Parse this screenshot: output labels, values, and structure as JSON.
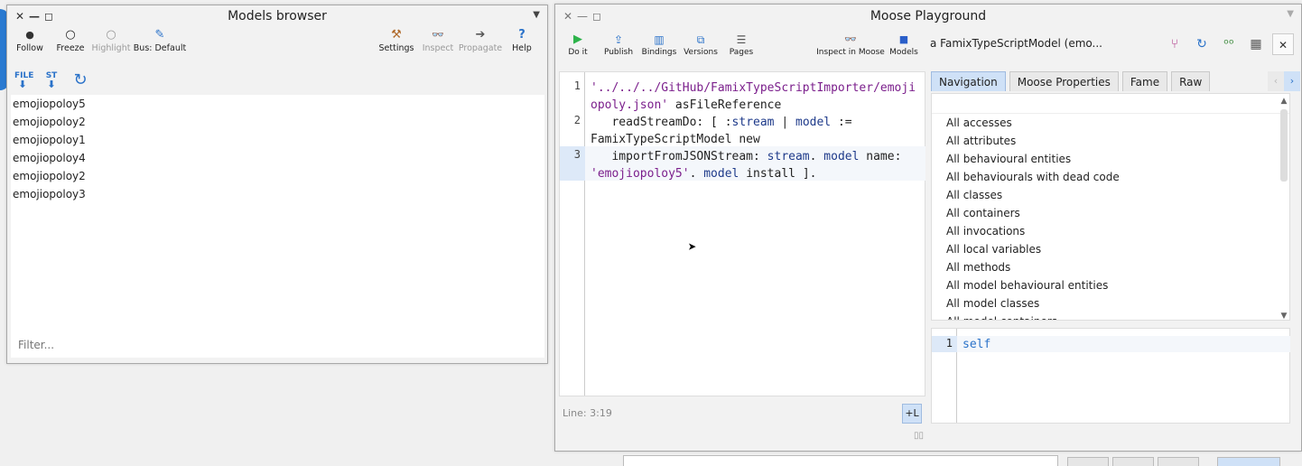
{
  "models_browser": {
    "title": "Models browser",
    "toolbar": [
      {
        "name": "follow",
        "label": "Follow",
        "icon": "●",
        "disabled": false
      },
      {
        "name": "freeze",
        "label": "Freeze",
        "icon": "○",
        "disabled": false
      },
      {
        "name": "highlight",
        "label": "Highlight",
        "icon": "○",
        "disabled": true
      },
      {
        "name": "bus",
        "label": "Bus: Default",
        "icon": "✎",
        "disabled": false
      },
      {
        "name": "settings",
        "label": "Settings",
        "icon": "⚒",
        "disabled": false
      },
      {
        "name": "inspect",
        "label": "Inspect",
        "icon": "👓",
        "disabled": true
      },
      {
        "name": "propagate",
        "label": "Propagate",
        "icon": "➔",
        "disabled": true
      },
      {
        "name": "help",
        "label": "Help",
        "icon": "?",
        "disabled": false
      }
    ],
    "icon_row": {
      "file_icon": "FILE",
      "st_icon": "ST",
      "refresh_icon": "↻"
    },
    "models": [
      "emojiopoloy5",
      "emojiopoloy2",
      "emojiopoloy1",
      "emojiopoloy4",
      "emojiopoloy2",
      "emojiopoloy3"
    ],
    "filter_placeholder": "Filter..."
  },
  "playground": {
    "title": "Moose Playground",
    "toolbar": [
      {
        "name": "do-it",
        "label": "Do it",
        "icon": "▶"
      },
      {
        "name": "publish",
        "label": "Publish",
        "icon": "⇪"
      },
      {
        "name": "bindings",
        "label": "Bindings",
        "icon": "▥"
      },
      {
        "name": "versions",
        "label": "Versions",
        "icon": "⧉"
      },
      {
        "name": "pages",
        "label": "Pages",
        "icon": "☰"
      },
      {
        "name": "inspect-in-moose",
        "label": "Inspect in Moose",
        "icon": "👓"
      },
      {
        "name": "models",
        "label": "Models",
        "icon": "■"
      }
    ],
    "model_label": "a FamixTypeScriptModel (emo...",
    "code_line_numbers": [
      "1",
      "2",
      "3"
    ],
    "code": {
      "l1a": "'../../../GitHub/FamixTypeScriptImporter/emoji",
      "l1b": "opoly.json'",
      "l1c": " asFileReference",
      "l2a": "   readStreamDo: [ :",
      "l2b": "stream",
      "l2c": " | ",
      "l2d": "model",
      "l2e": " :=",
      "l2f": "FamixTypeScriptModel new",
      "l3a": "   importFromJSONStream: ",
      "l3b": "stream",
      "l3c": ". ",
      "l3d": "model",
      "l3e": " name:",
      "l3f": "'emojiopoloy5'",
      "l3g": ". ",
      "l3h": "model",
      "l3i": " install ]."
    },
    "status": "Line: 3:19",
    "plus_l": "+L",
    "tabs": [
      {
        "label": "Navigation",
        "selected": true
      },
      {
        "label": "Moose Properties",
        "selected": false
      },
      {
        "label": "Fame",
        "selected": false
      },
      {
        "label": "Raw",
        "selected": false
      }
    ],
    "nav_items": [
      "All accesses",
      "All attributes",
      "All behavioural entities",
      "All behaviourals with dead code",
      "All classes",
      "All containers",
      "All invocations",
      "All local variables",
      "All methods",
      "All model behavioural entities",
      "All model classes",
      "All model containers"
    ],
    "mini_editor": {
      "line": "1",
      "code": "self"
    }
  },
  "colors": {
    "accent": "#2a72c9",
    "selected_tab": "#cfe1f7",
    "string": "#7b1f8c",
    "variable": "#1e3a8a"
  }
}
